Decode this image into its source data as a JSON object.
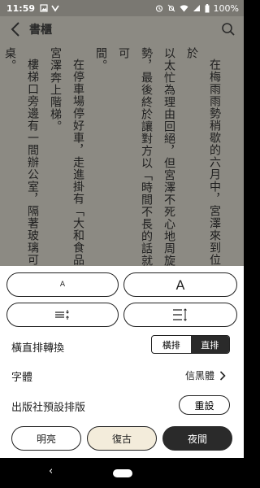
{
  "status_bar": {
    "time": "11:59",
    "battery": "100%",
    "icons": [
      "gallery-icon",
      "game-icon",
      "alarm-icon",
      "notifications-off-icon",
      "wifi-icon",
      "signal-icon",
      "battery-icon"
    ]
  },
  "reader": {
    "title": "書櫃",
    "paragraphs": [
      "在梅雨雨勢稍歇的六月中，宮澤來到位於",
      "以太忙為理由回絕，但宮澤不死心地周旋",
      "勢，最後終於讓對方以「時間不長的話就可",
      "間。",
      "在停車場停好車，走進掛有「大和食品",
      "宮澤奔上階梯。",
      "樓梯口旁邊有一間辦公室，隔著玻璃可",
      "桌。"
    ]
  },
  "settings": {
    "font_small_label": "A",
    "font_large_label": "A",
    "orientation_label": "橫直排轉換",
    "horizontal_label": "橫排",
    "vertical_label": "直排",
    "font_label": "字體",
    "font_value": "信黑體",
    "publisher_layout_label": "出版社預設排版",
    "reset_label": "重設",
    "theme_bright": "明亮",
    "theme_retro": "復古",
    "theme_night": "夜間"
  },
  "colors": {
    "retro_bg": "#f3ecdb",
    "night_bg": "#2a2a2a",
    "reader_overlay": "#8c8a83"
  }
}
